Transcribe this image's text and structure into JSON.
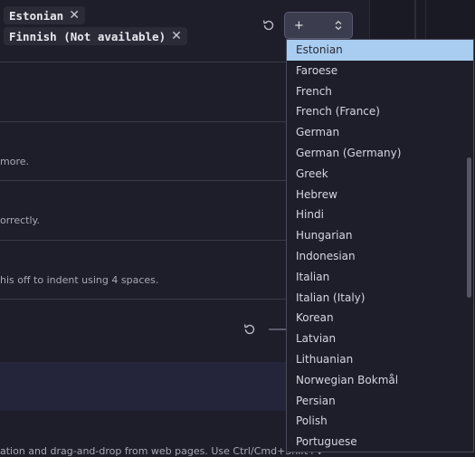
{
  "chips": [
    {
      "label": "Estonian"
    },
    {
      "label": "Finnish (Not available)"
    }
  ],
  "add_select": {
    "label": "+"
  },
  "descriptions": [
    "more.",
    "orrectly.",
    "his off to indent using 4 spaces.",
    "ation and drag-and-drop from web pages. Use Ctrl/Cmd+Shift+V"
  ],
  "dropdown": {
    "selected": "Estonian",
    "options": [
      "Estonian",
      "Faroese",
      "French",
      "French (France)",
      "German",
      "German (Germany)",
      "Greek",
      "Hebrew",
      "Hindi",
      "Hungarian",
      "Indonesian",
      "Italian",
      "Italian (Italy)",
      "Korean",
      "Latvian",
      "Lithuanian",
      "Norwegian Bokmål",
      "Persian",
      "Polish",
      "Portuguese"
    ]
  },
  "icons": {
    "remove": "close-icon",
    "reset": "reset-icon",
    "select": "chevron-updown-icon"
  }
}
